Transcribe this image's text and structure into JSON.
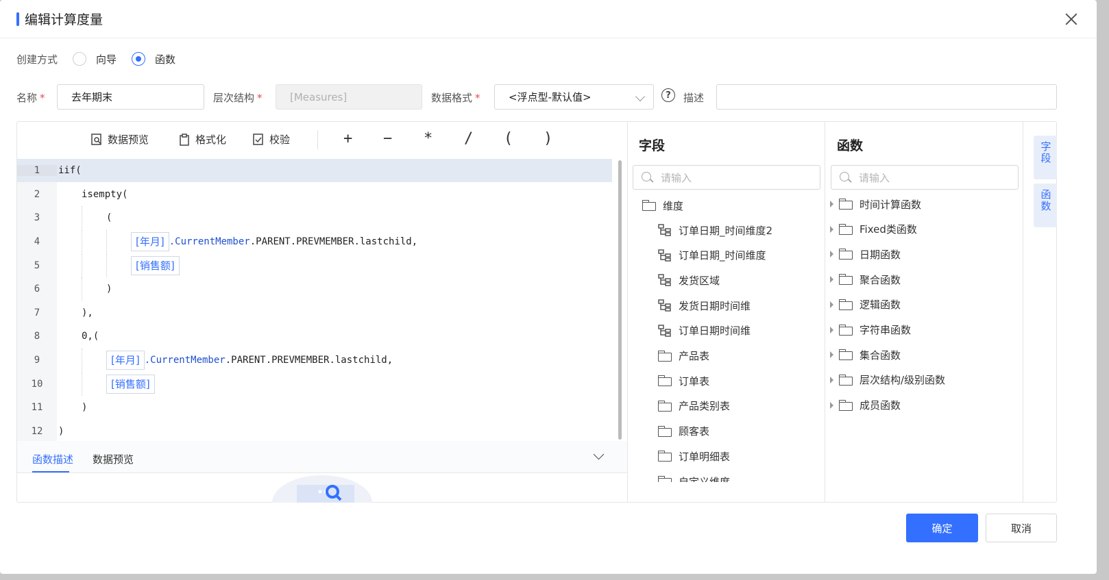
{
  "dialog": {
    "title": "编辑计算度量"
  },
  "creation": {
    "label": "创建方式",
    "options": [
      "向导",
      "函数"
    ],
    "selected": "函数"
  },
  "form": {
    "name_label": "名称",
    "name_value": "去年期末",
    "hierarchy_label": "层次结构",
    "hierarchy_value": "[Measures]",
    "format_label": "数据格式",
    "format_value": "<浮点型-默认值>",
    "desc_label": "描述",
    "desc_value": "",
    "help_icon": "?",
    "required_mark": "*"
  },
  "toolbar": {
    "preview": "数据预览",
    "format": "格式化",
    "validate": "校验",
    "ops": [
      "+",
      "−",
      "*",
      "/",
      "(",
      ")"
    ]
  },
  "code": {
    "line_numbers": [
      "1",
      "2",
      "3",
      "4",
      "5",
      "6",
      "7",
      "8",
      "9",
      "10",
      "11",
      "12"
    ],
    "l1": "iif(",
    "l2": "isempty(",
    "l3": "(",
    "tag_month": "[年月]",
    "tag_sales": "[销售额]",
    "cm": ".CurrentMember",
    "rest": ".PARENT.PREVMEMBER.lastchild,",
    "l6": ")",
    "l7": "),",
    "l8": "0,(",
    "l11": ")",
    "l12": ")"
  },
  "bottom_tabs": {
    "tab1": "函数描述",
    "tab2": "数据预览"
  },
  "fields_panel": {
    "title": "字段",
    "search_placeholder": "请输入",
    "root": "维度",
    "items": [
      {
        "label": "订单日期_时间维度2",
        "icon": "hierarchy-icon"
      },
      {
        "label": "订单日期_时间维度",
        "icon": "hierarchy-icon"
      },
      {
        "label": "发货区域",
        "icon": "hierarchy-icon"
      },
      {
        "label": "发货日期时间维",
        "icon": "hierarchy-icon"
      },
      {
        "label": "订单日期时间维",
        "icon": "hierarchy-icon"
      },
      {
        "label": "产品表",
        "icon": "folder-icon"
      },
      {
        "label": "订单表",
        "icon": "folder-icon"
      },
      {
        "label": "产品类别表",
        "icon": "folder-icon"
      },
      {
        "label": "顾客表",
        "icon": "folder-icon"
      },
      {
        "label": "订单明细表",
        "icon": "folder-icon"
      },
      {
        "label": "自定义维度",
        "icon": "folder-icon"
      }
    ]
  },
  "functions_panel": {
    "title": "函数",
    "search_placeholder": "请输入",
    "items": [
      "时间计算函数",
      "Fixed类函数",
      "日期函数",
      "聚合函数",
      "逻辑函数",
      "字符串函数",
      "集合函数",
      "层次结构/级别函数",
      "成员函数"
    ]
  },
  "side_tabs": {
    "fields": "字段",
    "functions": "函数"
  },
  "footer": {
    "confirm": "确定",
    "cancel": "取消"
  },
  "colors": {
    "accent": "#3370ff",
    "required": "#e34d59"
  }
}
